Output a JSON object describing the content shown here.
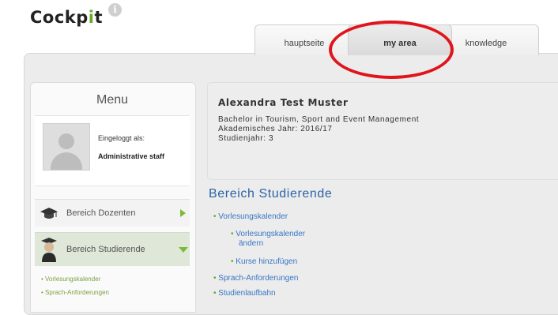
{
  "header": {
    "logo_prefix": "Cockp",
    "logo_i": "i",
    "logo_suffix": "t",
    "info_icon": "i"
  },
  "tabs": [
    {
      "label": "hauptseite",
      "active": false
    },
    {
      "label": "my area",
      "active": true
    },
    {
      "label": "knowledge",
      "active": false
    }
  ],
  "sidebar": {
    "title": "Menu",
    "logged_in_label": "Eingeloggt als:",
    "role": "Administrative staff",
    "items": [
      {
        "label": "Bereich Dozenten",
        "icon": "graduation-cap-icon"
      },
      {
        "label": "Bereich Studierende",
        "icon": "student-icon"
      }
    ],
    "sub_items": [
      "Vorlesungskalender",
      "Sprach-Anforderungen"
    ]
  },
  "profile": {
    "name": "Alexandra Test Muster",
    "program": "Bachelor in Tourism, Sport and Event Management",
    "year": "Akademisches Jahr: 2016/17",
    "study_year": "Studienjahr: 3"
  },
  "main": {
    "section_title": "Bereich Studierende",
    "links": {
      "l1": "Vorlesungskalender",
      "l1a_line1": "Vorlesungskalender",
      "l1a_line2": "ändern",
      "l1b": "Kurse hinzufügen",
      "l2": "Sprach-Anforderungen",
      "l3": "Studienlaufbahn"
    }
  },
  "colors": {
    "accent_green": "#6aa92b",
    "link_blue": "#3875c5",
    "highlight_red": "#e0141b"
  }
}
